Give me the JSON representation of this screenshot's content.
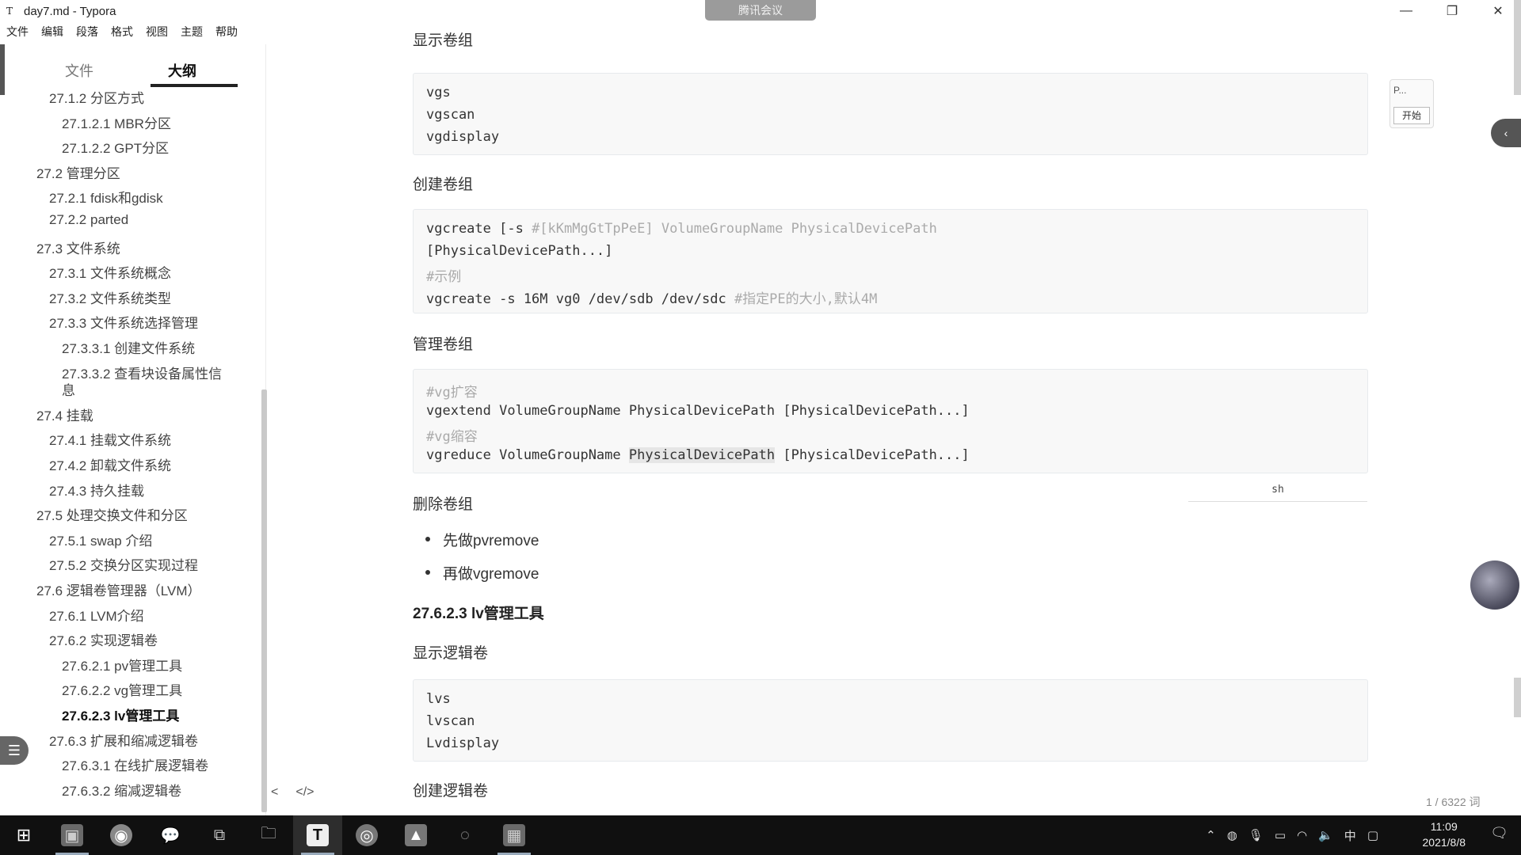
{
  "window": {
    "title": "day7.md - Typora",
    "app_icon": "T",
    "minimize": "—",
    "restore": "❐",
    "close": "✕"
  },
  "meeting_badge": "腾讯会议",
  "menu": [
    "文件",
    "编辑",
    "段落",
    "格式",
    "视图",
    "主题",
    "帮助"
  ],
  "sidebar": {
    "tabs": [
      {
        "label": "文件"
      },
      {
        "label": "大纲"
      }
    ],
    "active_tab": "大纲",
    "outline": [
      {
        "text": "27.1.2 分区方式",
        "level": 2
      },
      {
        "text": "27.1.2.1 MBR分区",
        "level": 3
      },
      {
        "text": "27.1.2.2 GPT分区",
        "level": 3
      },
      {
        "text": "27.2 管理分区",
        "level": 1
      },
      {
        "text": "27.2.1 fdisk和gdisk",
        "level": 2
      },
      {
        "text": "27.2.2 parted",
        "level": 2
      },
      {
        "text": "27.3 文件系统",
        "level": 1
      },
      {
        "text": "27.3.1 文件系统概念",
        "level": 2
      },
      {
        "text": "27.3.2 文件系统类型",
        "level": 2
      },
      {
        "text": "27.3.3 文件系统选择管理",
        "level": 2
      },
      {
        "text": "27.3.3.1 创建文件系统",
        "level": 3
      },
      {
        "text": "27.3.3.2 查看块设备属性信",
        "level": 3
      },
      {
        "text": "息",
        "level": 3
      },
      {
        "text": "27.4 挂载",
        "level": 1
      },
      {
        "text": "27.4.1 挂载文件系统",
        "level": 2
      },
      {
        "text": "27.4.2 卸载文件系统",
        "level": 2
      },
      {
        "text": "27.4.3 持久挂载",
        "level": 2
      },
      {
        "text": "27.5 处理交换文件和分区",
        "level": 1
      },
      {
        "text": "27.5.1 swap 介绍",
        "level": 2
      },
      {
        "text": "27.5.2 交换分区实现过程",
        "level": 2
      },
      {
        "text": "27.6 逻辑卷管理器（LVM）",
        "level": 1
      },
      {
        "text": "27.6.1 LVM介绍",
        "level": 2
      },
      {
        "text": "27.6.2 实现逻辑卷",
        "level": 2
      },
      {
        "text": "27.6.2.1 pv管理工具",
        "level": 3
      },
      {
        "text": "27.6.2.2 vg管理工具",
        "level": 3
      },
      {
        "text": "27.6.2.3 lv管理工具",
        "level": 3,
        "active": true
      },
      {
        "text": "27.6.3 扩展和缩减逻辑卷",
        "level": 2
      },
      {
        "text": "27.6.3.1 在线扩展逻辑卷",
        "level": 3
      },
      {
        "text": "27.6.3.2 缩减逻辑卷",
        "level": 3
      }
    ],
    "footer": {
      "back": "<",
      "source": "</>"
    }
  },
  "editor": {
    "top_heading": "显示卷组",
    "code1": [
      "vgs",
      "vgscan",
      "vgdisplay"
    ],
    "h_create_vg": "创建卷组",
    "code2": {
      "l1_cmd": "vgcreate [-s ",
      "l1_comment": "#[kKmMgGtTpPeE]",
      "l1_rest": " VolumeGroupName PhysicalDevicePath",
      "l2": "[PhysicalDevicePath...]",
      "l3_comment": "#示例",
      "l4_cmd": "vgcreate -s 16M vg0 /dev/sdb /dev/sdc ",
      "l4_comment": "#指定PE的大小,默认4M"
    },
    "h_manage_vg": "管理卷组",
    "code3": {
      "l1_comment": "#vg扩容",
      "l2": "vgextend VolumeGroupName PhysicalDevicePath [PhysicalDevicePath...]",
      "l3_comment": "#vg缩容",
      "l4_a": "vgreduce VolumeGroupName ",
      "l4_hl": "PhysicalDevicePath",
      "l4_b": " [PhysicalDevicePath...]"
    },
    "code_lang": "sh",
    "h_delete_vg": "删除卷组",
    "bullets": [
      "先做pvremove",
      "再做vgremove"
    ],
    "h3_lv": "27.6.2.3 lv管理工具",
    "h_show_lv": "显示逻辑卷",
    "code4": [
      "lvs",
      "lvscan",
      "Lvdisplay"
    ],
    "h_create_lv": "创建逻辑卷",
    "word_count": "1 / 6322 词"
  },
  "floating": {
    "pin_label": "P...",
    "start_label": "开始"
  },
  "taskbar": {
    "apps": [
      "windows-start",
      "image-viewer",
      "chrome",
      "wechat",
      "task-view",
      "file-manager",
      "typora",
      "netease-music",
      "photos",
      "browser",
      "screen-recorder"
    ],
    "tray_lang": "中",
    "time": "11:09",
    "date": "2021/8/8"
  }
}
